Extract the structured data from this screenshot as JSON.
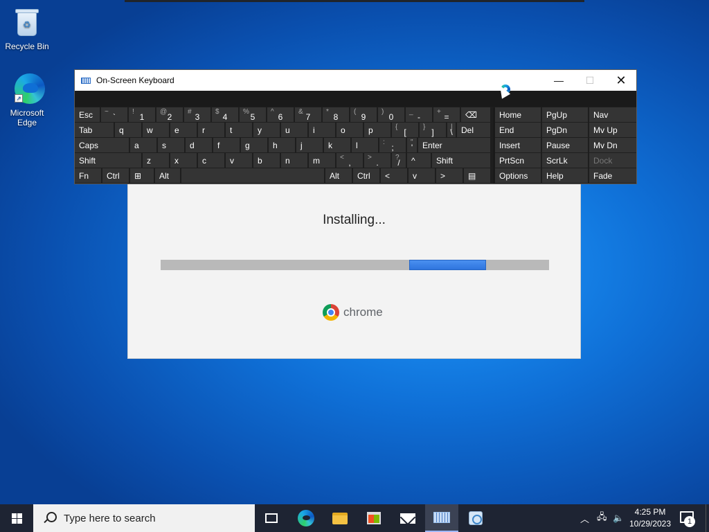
{
  "desktop": {
    "icons": [
      {
        "label": "Recycle Bin"
      },
      {
        "label": "Microsoft Edge"
      }
    ]
  },
  "installer": {
    "status_text": "Installing...",
    "progress_indeterminate": true,
    "brand_text": "chrome"
  },
  "osk": {
    "title": "On-Screen Keyboard",
    "rows": [
      [
        {
          "main": "Esc"
        },
        {
          "shift": "~",
          "main": "`"
        },
        {
          "shift": "!",
          "main": "1"
        },
        {
          "shift": "@",
          "main": "2"
        },
        {
          "shift": "#",
          "main": "3"
        },
        {
          "shift": "$",
          "main": "4"
        },
        {
          "shift": "%",
          "main": "5"
        },
        {
          "shift": "^",
          "main": "6"
        },
        {
          "shift": "&",
          "main": "7"
        },
        {
          "shift": "*",
          "main": "8"
        },
        {
          "shift": "(",
          "main": "9"
        },
        {
          "shift": ")",
          "main": "0"
        },
        {
          "shift": "_",
          "main": "-"
        },
        {
          "shift": "+",
          "main": "="
        },
        {
          "main": "⌫"
        }
      ],
      [
        {
          "main": "Tab"
        },
        {
          "main": "q"
        },
        {
          "main": "w"
        },
        {
          "main": "e"
        },
        {
          "main": "r"
        },
        {
          "main": "t"
        },
        {
          "main": "y"
        },
        {
          "main": "u"
        },
        {
          "main": "i"
        },
        {
          "main": "o"
        },
        {
          "main": "p"
        },
        {
          "shift": "{",
          "main": "["
        },
        {
          "shift": "}",
          "main": "]"
        },
        {
          "shift": "|",
          "main": "\\"
        },
        {
          "main": "Del"
        }
      ],
      [
        {
          "main": "Caps"
        },
        {
          "main": "a"
        },
        {
          "main": "s"
        },
        {
          "main": "d"
        },
        {
          "main": "f"
        },
        {
          "main": "g"
        },
        {
          "main": "h"
        },
        {
          "main": "j"
        },
        {
          "main": "k"
        },
        {
          "main": "l"
        },
        {
          "shift": ":",
          "main": ";"
        },
        {
          "shift": "\"",
          "main": "'"
        },
        {
          "main": "Enter"
        }
      ],
      [
        {
          "main": "Shift"
        },
        {
          "main": "z"
        },
        {
          "main": "x"
        },
        {
          "main": "c"
        },
        {
          "main": "v"
        },
        {
          "main": "b"
        },
        {
          "main": "n"
        },
        {
          "main": "m"
        },
        {
          "shift": "<",
          "main": ","
        },
        {
          "shift": ">",
          "main": "."
        },
        {
          "shift": "?",
          "main": "/"
        },
        {
          "main": "^"
        },
        {
          "main": "Shift"
        }
      ],
      [
        {
          "main": "Fn"
        },
        {
          "main": "Ctrl"
        },
        {
          "main": "⊞"
        },
        {
          "main": "Alt"
        },
        {
          "main": ""
        },
        {
          "main": "Alt"
        },
        {
          "main": "Ctrl"
        },
        {
          "main": "<"
        },
        {
          "main": "v"
        },
        {
          "main": ">"
        },
        {
          "main": "▤"
        }
      ]
    ],
    "nav_keys": [
      [
        "Home",
        "PgUp",
        "Nav"
      ],
      [
        "End",
        "PgDn",
        "Mv Up"
      ],
      [
        "Insert",
        "Pause",
        "Mv Dn"
      ],
      [
        "PrtScn",
        "ScrLk",
        "Dock"
      ],
      [
        "Options",
        "Help",
        "Fade"
      ]
    ]
  },
  "taskbar": {
    "search_placeholder": "Type here to search",
    "apps": [
      "Task View",
      "Microsoft Edge",
      "File Explorer",
      "Microsoft Store",
      "Mail",
      "On-Screen Keyboard",
      "Installer"
    ],
    "time": "4:25 PM",
    "date": "10/29/2023",
    "notification_count": "1"
  }
}
